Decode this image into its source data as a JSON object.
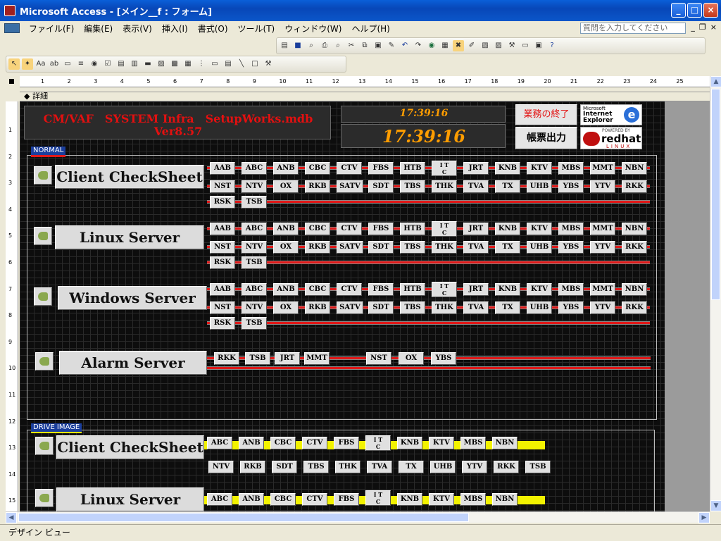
{
  "window": {
    "title": "Microsoft Access - [メイン__f : フォーム]",
    "minimize": "_",
    "maximize": "□",
    "close": "×"
  },
  "menu": {
    "items": [
      "ファイル(F)",
      "編集(E)",
      "表示(V)",
      "挿入(I)",
      "書式(O)",
      "ツール(T)",
      "ウィンドウ(W)",
      "ヘルプ(H)"
    ],
    "ask_placeholder": "質問を入力してください"
  },
  "ruler": {
    "numbers": [
      "1",
      "2",
      "3",
      "4",
      "5",
      "6",
      "7",
      "8",
      "9",
      "10",
      "11",
      "12",
      "13",
      "14",
      "15",
      "16",
      "17",
      "18",
      "19",
      "20",
      "21",
      "22",
      "23",
      "24",
      "25"
    ]
  },
  "vruler": {
    "numbers": [
      "1",
      "2",
      "3",
      "4",
      "5",
      "6",
      "7",
      "8",
      "9",
      "10",
      "11",
      "12",
      "13",
      "14",
      "15"
    ]
  },
  "section_label": "詳細",
  "header": {
    "title_line1": "CM/VAF　SYSTEM Infra　SetupWorks.mdb",
    "title_line2": "Ver8.57",
    "clock_small": "17:39:16",
    "clock_large": "17:39:16",
    "end_button": "業務の終了",
    "report_button": "帳票出力",
    "ie_logo_line1": "Microsoft",
    "ie_logo_line2": "Internet",
    "ie_logo_line3": "Explorer",
    "rh_line1": "POWERED BY",
    "rh_line2": "redhat",
    "rh_line3": "LINUX"
  },
  "normal_frame_label": "NORMAL",
  "drive_frame_label": "DRIVE IMAGE",
  "normal": {
    "client": {
      "label": "Client  CheckSheet",
      "row1": [
        "AAB",
        "ABC",
        "ANB",
        "CBC",
        "CTV",
        "FBS",
        "HTB",
        "ITC",
        "JRT",
        "KNB",
        "KTV",
        "MBS",
        "MMT",
        "NBN"
      ],
      "row2": [
        "NST",
        "NTV",
        "OX",
        "RKB",
        "SATV",
        "SDT",
        "TBS",
        "THK",
        "TVA",
        "TX",
        "UHB",
        "YBS",
        "YTV",
        "RKK"
      ],
      "row3": [
        "RSK",
        "TSB"
      ]
    },
    "linux": {
      "label": "Linux Server",
      "row1": [
        "AAB",
        "ABC",
        "ANB",
        "CBC",
        "CTV",
        "FBS",
        "HTB",
        "ITC",
        "JRT",
        "KNB",
        "KTV",
        "MBS",
        "MMT",
        "NBN"
      ],
      "row2": [
        "NST",
        "NTV",
        "OX",
        "RKB",
        "SATV",
        "SDT",
        "TBS",
        "THK",
        "TVA",
        "TX",
        "UHB",
        "YBS",
        "YTV",
        "RKK"
      ],
      "row3": [
        "RSK",
        "TSB"
      ]
    },
    "windows": {
      "label": "Windows Server",
      "row1": [
        "AAB",
        "ABC",
        "ANB",
        "CBC",
        "CTV",
        "FBS",
        "HTB",
        "ITC",
        "JRT",
        "KNB",
        "KTV",
        "MBS",
        "MMT",
        "NBN"
      ],
      "row2": [
        "NST",
        "NTV",
        "OX",
        "RKB",
        "SATV",
        "SDT",
        "TBS",
        "THK",
        "TVA",
        "TX",
        "UHB",
        "YBS",
        "YTV",
        "RKK"
      ],
      "row3": [
        "RSK",
        "TSB"
      ]
    },
    "alarm": {
      "label": "Alarm Server",
      "row1": [
        "RKK",
        "TSB",
        "JRT",
        "MMT",
        "NST",
        "OX",
        "YBS"
      ]
    }
  },
  "drive": {
    "client": {
      "label": "Client  CheckSheet",
      "row1": [
        "ABC",
        "ANB",
        "CBC",
        "CTV",
        "FBS",
        "ITC",
        "KNB",
        "KTV",
        "MBS",
        "NBN"
      ],
      "row2": [
        "NTV",
        "RKB",
        "SDT",
        "TBS",
        "THK",
        "TVA",
        "TX",
        "UHB",
        "YTV",
        "RKK",
        "TSB"
      ]
    },
    "linux": {
      "label": "Linux Server",
      "row1": [
        "ABC",
        "ANB",
        "CBC",
        "CTV",
        "FBS",
        "ITC",
        "KNB",
        "KTV",
        "MBS",
        "NBN"
      ]
    }
  },
  "status": "デザイン ビュー",
  "colors": {
    "accent_red": "#e01818",
    "clock_orange": "#ff9d00",
    "drive_yellow": "#f2f200"
  }
}
